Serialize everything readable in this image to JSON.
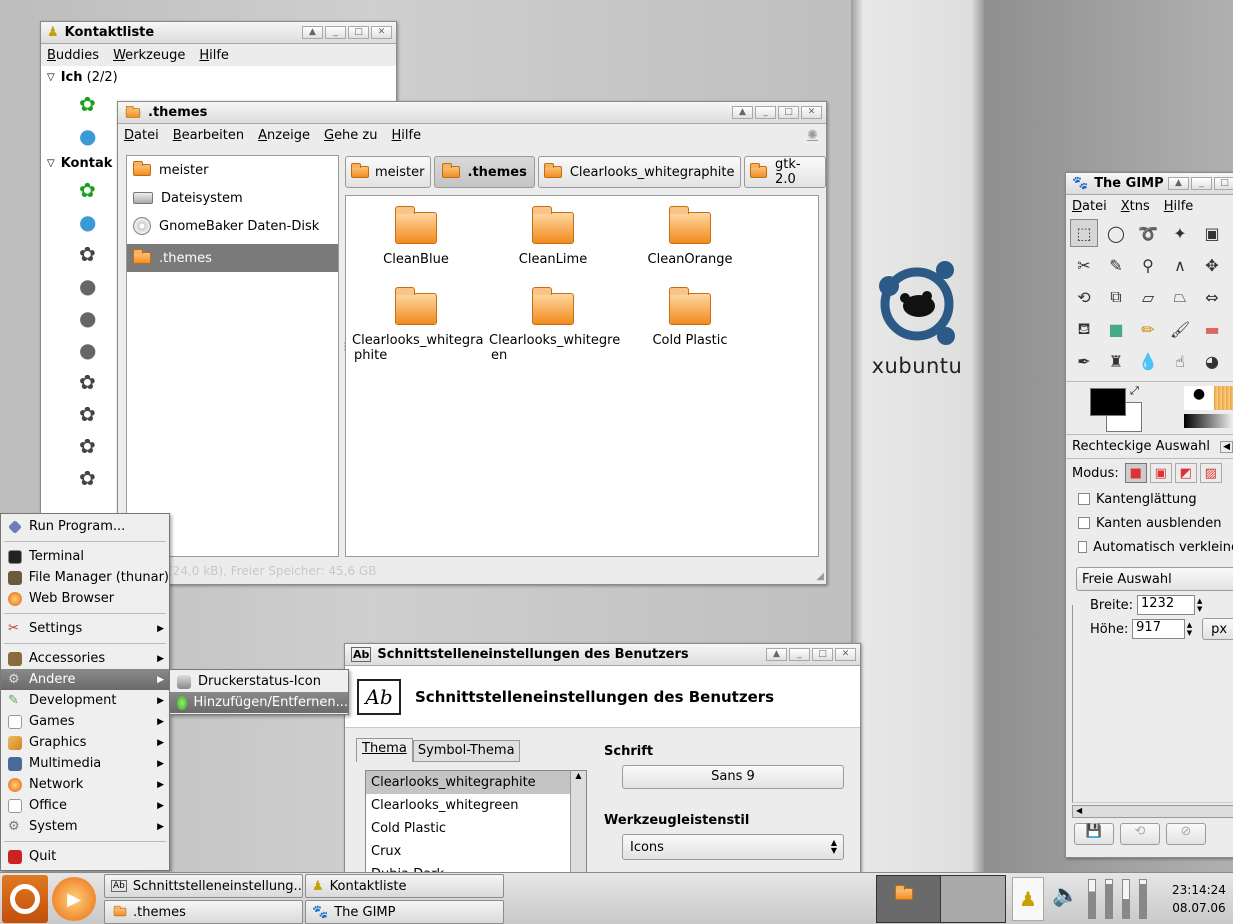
{
  "desktop": {
    "logo_text": "xubuntu"
  },
  "pidgin": {
    "title": "Kontaktliste",
    "menu": [
      "Buddies",
      "Werkzeuge",
      "Hilfe"
    ],
    "group_me": "Ich",
    "group_me_count": "(2/2)",
    "group_contacts": "Kontak"
  },
  "thunar": {
    "title": ".themes",
    "menu": [
      "Datei",
      "Bearbeiten",
      "Anzeige",
      "Gehe zu",
      "Hilfe"
    ],
    "side_items": [
      "meister",
      "Dateisystem",
      "GnomeBaker Daten-Disk",
      ".themes"
    ],
    "path": [
      "meister",
      ".themes",
      "Clearlooks_whitegraphite",
      "gtk-2.0"
    ],
    "files": [
      {
        "l1": "CleanBlue",
        "l2": ""
      },
      {
        "l1": "CleanLime",
        "l2": ""
      },
      {
        "l1": "CleanOrange",
        "l2": ""
      },
      {
        "l1": "Clearlooks_whitegra",
        "l2": "phite"
      },
      {
        "l1": "Clearlooks_whitegre",
        "l2": "en"
      },
      {
        "l1": "Cold Plastic",
        "l2": ""
      }
    ],
    "status": "(24,0 kB), Freier Speicher: 45,6 GB"
  },
  "gimp": {
    "title": "The GIMP",
    "menu": [
      "Datei",
      "Xtns",
      "Hilfe"
    ],
    "tool_name": "Rechteckige Auswahl",
    "mode_label": "Modus:",
    "opts": [
      "Kantenglättung",
      "Kanten ausblenden",
      "Automatisch verkleine"
    ],
    "select": "Freie Auswahl",
    "width_label": "Breite:",
    "width_value": "1232",
    "height_label": "Höhe:",
    "height_value": "917",
    "unit": "px"
  },
  "ui_settings": {
    "title": "Schnittstelleneinstellungen des Benutzers",
    "heading": "Schnittstelleneinstellungen des Benutzers",
    "tabs": [
      "Thema",
      "Symbol-Thema"
    ],
    "themes": [
      "Clearlooks_whitegraphite",
      "Clearlooks_whitegreen",
      "Cold Plastic",
      "Crux",
      "Dubia Dark"
    ],
    "font_label": "Schrift",
    "font_value": "Sans 9",
    "toolbar_label": "Werkzeugleistenstil",
    "toolbar_value": "Icons"
  },
  "menu": {
    "run": "Run Program...",
    "items1": [
      "Terminal",
      "File Manager (thunar)",
      "Web Browser"
    ],
    "settings": "Settings",
    "items2": [
      "Accessories",
      "Andere",
      "Development",
      "Games",
      "Graphics",
      "Multimedia",
      "Network",
      "Office",
      "System"
    ],
    "quit": "Quit",
    "submenu": [
      "Druckerstatus-Icon",
      "Hinzufügen/Entfernen..."
    ]
  },
  "taskbar": {
    "tasks": [
      "Schnittstelleneinstellung...",
      "Kontaktliste",
      ".themes",
      "The GIMP"
    ],
    "time": "23:14:24",
    "date": "08.07.06"
  },
  "colors": {
    "selection": "#7a7a7a",
    "folder": "#f28f22"
  }
}
